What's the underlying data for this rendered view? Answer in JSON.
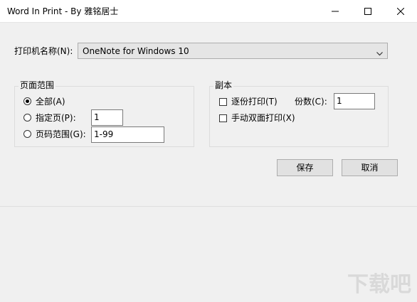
{
  "window": {
    "title": "Word In Print - By 雅铭居士",
    "controls": {
      "minimize": "minimize-icon",
      "maximize": "maximize-icon",
      "close": "close-icon"
    }
  },
  "printer": {
    "label": "打印机名称(N):",
    "selected": "OneNote for Windows 10"
  },
  "page_range": {
    "title": "页面范围",
    "options": [
      {
        "label": "全部(A)",
        "checked": true
      },
      {
        "label": "指定页(P):",
        "checked": false,
        "value": "1"
      },
      {
        "label": "页码范围(G):",
        "checked": false,
        "value": "1-99"
      }
    ]
  },
  "copies": {
    "title": "副本",
    "collate_label": "逐份打印(T)",
    "collate_checked": false,
    "count_label": "份数(C):",
    "count_value": "1",
    "duplex_label": "手动双面打印(X)",
    "duplex_checked": false
  },
  "buttons": {
    "save": "保存",
    "cancel": "取消"
  },
  "watermark": {
    "text": "下载吧"
  }
}
